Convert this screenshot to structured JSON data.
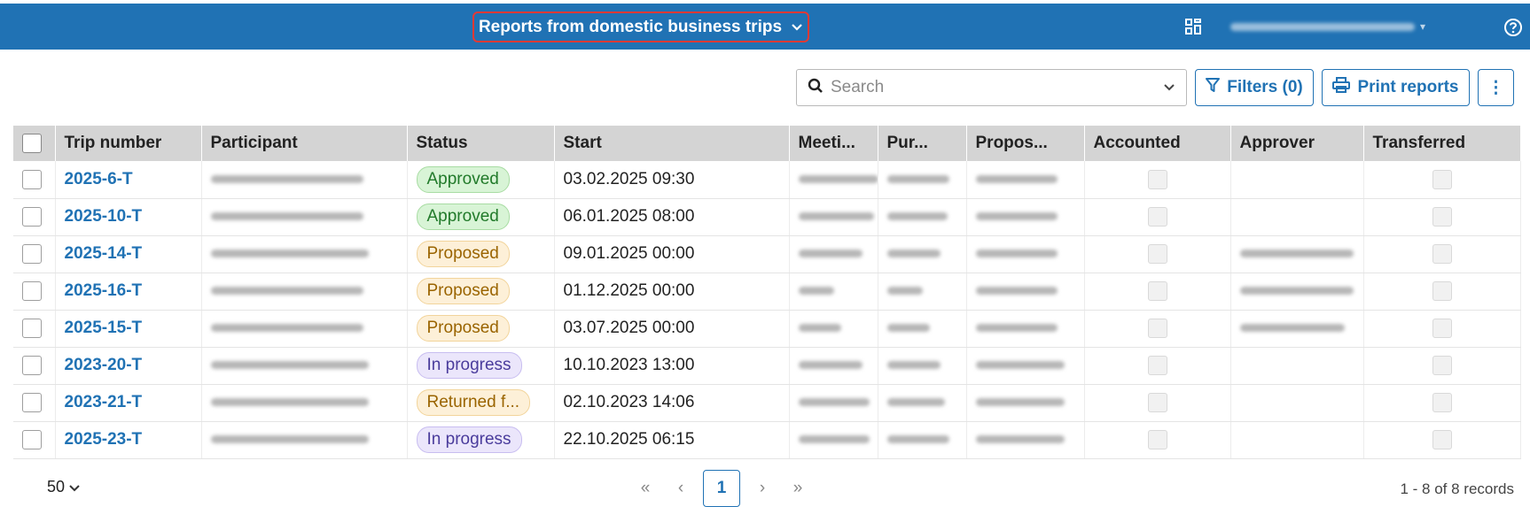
{
  "header": {
    "view_title": "Reports from domestic business trips"
  },
  "toolbar": {
    "search_placeholder": "Search",
    "filters_label": "Filters (0)",
    "print_label": "Print reports",
    "more_label": "⋮"
  },
  "table": {
    "columns": [
      "Trip number",
      "Participant",
      "Status",
      "Start",
      "Meeti...",
      "Pur...",
      "Propos...",
      "Accounted",
      "Approver",
      "Transferred"
    ],
    "rows": [
      {
        "trip": "2025-6-T",
        "status": "Approved",
        "status_kind": "approved",
        "start": "03.02.2025 09:30",
        "has_approver": false
      },
      {
        "trip": "2025-10-T",
        "status": "Approved",
        "status_kind": "approved",
        "start": "06.01.2025 08:00",
        "has_approver": false
      },
      {
        "trip": "2025-14-T",
        "status": "Proposed",
        "status_kind": "proposed",
        "start": "09.01.2025 00:00",
        "has_approver": true
      },
      {
        "trip": "2025-16-T",
        "status": "Proposed",
        "status_kind": "proposed",
        "start": "01.12.2025 00:00",
        "has_approver": true
      },
      {
        "trip": "2025-15-T",
        "status": "Proposed",
        "status_kind": "proposed",
        "start": "03.07.2025 00:00",
        "has_approver": true
      },
      {
        "trip": "2023-20-T",
        "status": "In progress",
        "status_kind": "progress",
        "start": "10.10.2023 13:00",
        "has_approver": false
      },
      {
        "trip": "2023-21-T",
        "status": "Returned f...",
        "status_kind": "returned",
        "start": "02.10.2023 14:06",
        "has_approver": false
      },
      {
        "trip": "2025-23-T",
        "status": "In progress",
        "status_kind": "progress",
        "start": "22.10.2025 06:15",
        "has_approver": false
      }
    ]
  },
  "footer": {
    "page_size": "50",
    "current_page": "1",
    "first_label": "«",
    "prev_label": "‹",
    "next_label": "›",
    "last_label": "»",
    "records_label": "1 - 8 of 8 records"
  },
  "colors": {
    "header_bg": "#2072b4",
    "accent": "#2072b4",
    "highlight_border": "#e53935"
  }
}
